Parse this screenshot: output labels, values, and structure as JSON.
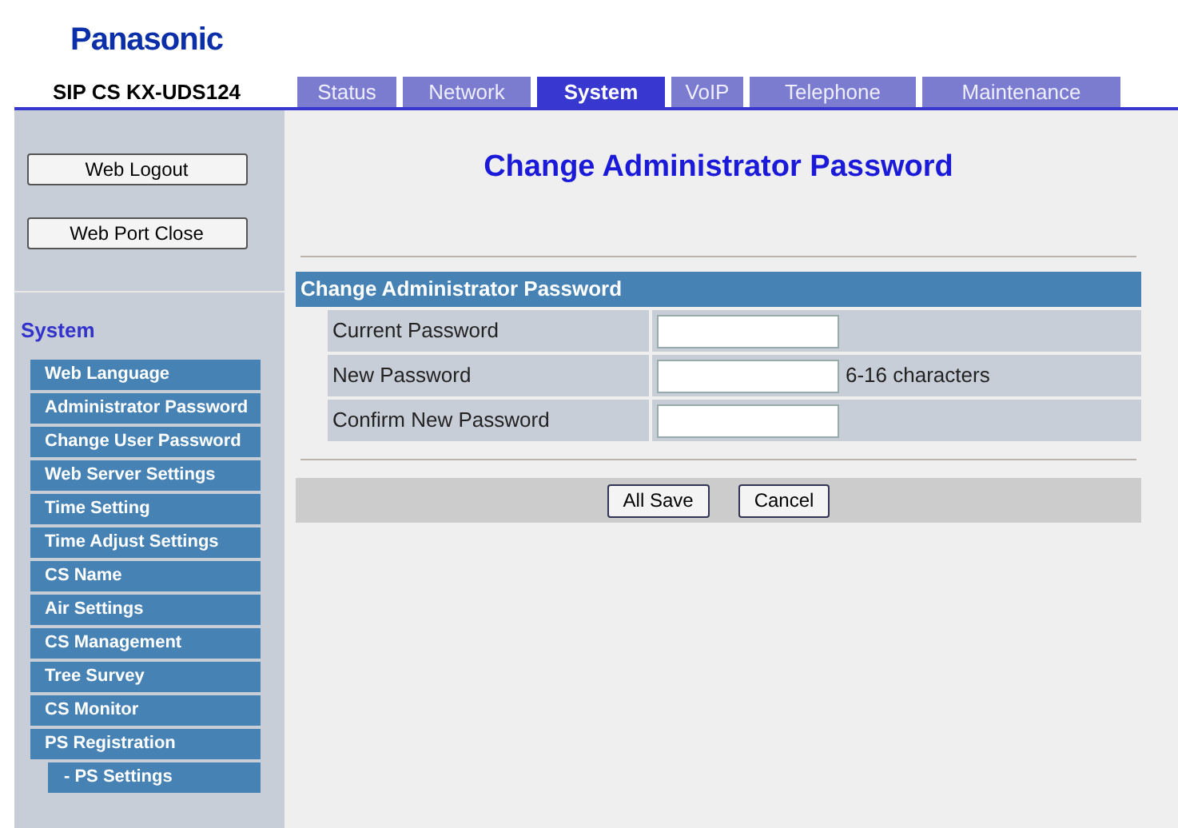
{
  "logo": "Panasonic",
  "model": "SIP CS KX-UDS124",
  "tabs": [
    {
      "label": "Status",
      "selected": false
    },
    {
      "label": "Network",
      "selected": false
    },
    {
      "label": "System",
      "selected": true
    },
    {
      "label": "VoIP",
      "selected": false
    },
    {
      "label": "Telephone",
      "selected": false
    },
    {
      "label": "Maintenance",
      "selected": false
    }
  ],
  "sidebar": {
    "buttons": [
      "Web Logout",
      "Web Port Close"
    ],
    "section": "System",
    "items": [
      {
        "label": "Web Language"
      },
      {
        "label": "Administrator Password"
      },
      {
        "label": "Change User Password"
      },
      {
        "label": "Web Server Settings"
      },
      {
        "label": "Time Setting"
      },
      {
        "label": "Time Adjust Settings"
      },
      {
        "label": "CS Name"
      },
      {
        "label": "Air Settings"
      },
      {
        "label": "CS Management"
      },
      {
        "label": "Tree Survey"
      },
      {
        "label": "CS Monitor"
      },
      {
        "label": "PS Registration",
        "children": [
          {
            "label": "- PS Settings"
          }
        ]
      }
    ]
  },
  "page_title": "Change Administrator Password",
  "form": {
    "title": "Change Administrator Password",
    "rows": [
      {
        "label": "Current Password"
      },
      {
        "label": "New Password",
        "hint": "6-16 characters"
      },
      {
        "label": "Confirm New Password"
      }
    ]
  },
  "buttons": [
    "All Save",
    "Cancel"
  ]
}
